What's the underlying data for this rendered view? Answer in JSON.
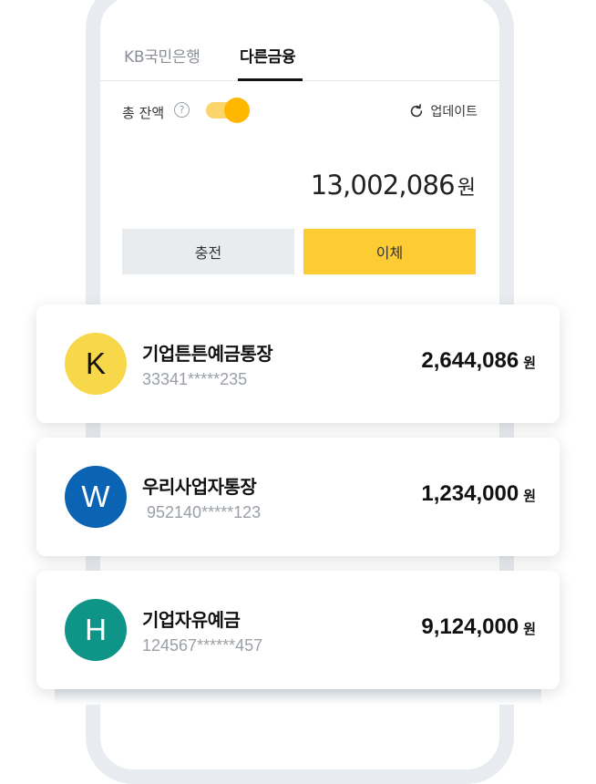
{
  "tabs": [
    {
      "label": "KB국민은행",
      "active": false
    },
    {
      "label": "다른금융",
      "active": true
    }
  ],
  "balance": {
    "label": "총 잔액",
    "help_icon": "question-circle-icon",
    "toggle_on": true,
    "update_label": "업데이트",
    "update_icon": "refresh-icon",
    "total_amount": "13,002,086",
    "total_unit": "원"
  },
  "actions": {
    "charge_label": "충전",
    "transfer_label": "이체"
  },
  "accounts": [
    {
      "initial": "K",
      "name": "기업튼튼예금통장",
      "number": "33341*****235",
      "amount": "2,644,086",
      "unit": "원",
      "avatar_color": "#f7d84b",
      "initial_color": "#111111"
    },
    {
      "initial": "W",
      "name": "우리사업자통장",
      "number": "952140*****123",
      "amount": "1,234,000",
      "unit": "원",
      "avatar_color": "#0b63b4",
      "initial_color": "#ffffff"
    },
    {
      "initial": "H",
      "name": "기업자유예금",
      "number": "124567******457",
      "amount": "9,124,000",
      "unit": "원",
      "avatar_color": "#0f9488",
      "initial_color": "#ffffff"
    }
  ],
  "colors": {
    "accent_yellow": "#fdcc32",
    "toggle_track": "#fbd46a",
    "toggle_knob": "#ffb700",
    "button_gray": "#e9ecef",
    "phone_frame": "#e8ecf0"
  }
}
